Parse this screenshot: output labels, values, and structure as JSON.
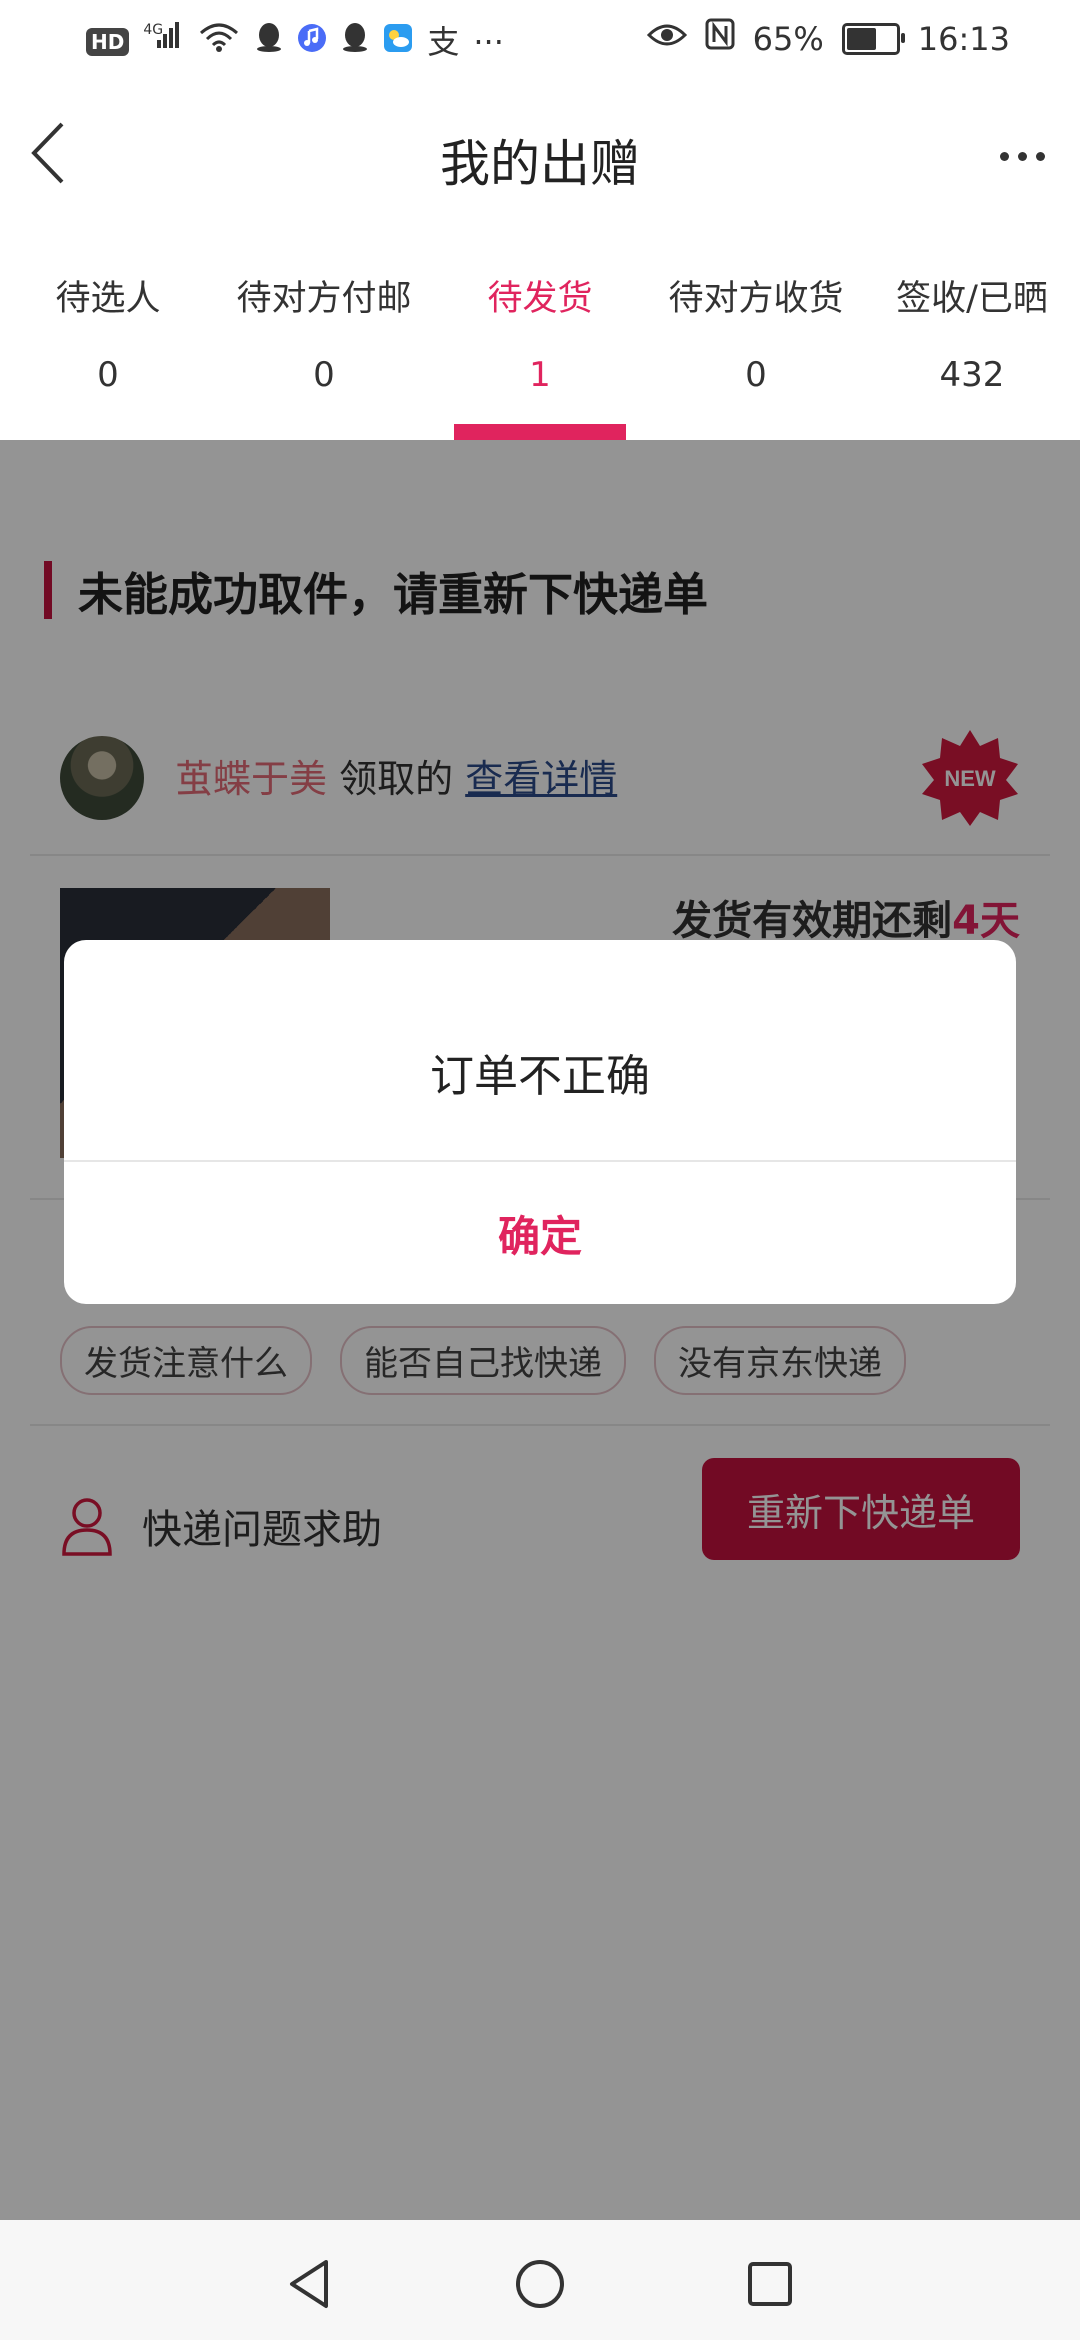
{
  "status_bar": {
    "left_badges": [
      "HD",
      "4G"
    ],
    "icons": [
      "signal-icon",
      "wifi-icon",
      "qq-icon",
      "music-icon",
      "qq-icon",
      "weather-icon",
      "alipay-icon",
      "more-notifications-icon"
    ],
    "alipay_glyph": "支",
    "overflow": "···",
    "battery_percent": "65%",
    "battery_level": 0.65,
    "time": "16:13"
  },
  "header": {
    "title": "我的出赠"
  },
  "tabs": [
    {
      "label": "待选人",
      "count": "0"
    },
    {
      "label": "待对方付邮",
      "count": "0"
    },
    {
      "label": "待发货",
      "count": "1",
      "active": true
    },
    {
      "label": "待对方收货",
      "count": "0"
    },
    {
      "label": "签收/已晒",
      "count": "432"
    }
  ],
  "section": {
    "title": "未能成功取件，请重新下快递单"
  },
  "card": {
    "giver_name": "茧蝶于美",
    "claimed_text": " 领取的 ",
    "details_link": "查看详情",
    "badge": "NEW",
    "deadline_prefix": "发货有效期还剩",
    "deadline_days": "4天",
    "chips": [
      "发货注意什么",
      "能否自己找快递",
      "没有京东快递"
    ],
    "help_text": "快递问题求助",
    "reorder_button": "重新下快递单"
  },
  "dialog": {
    "message": "订单不正确",
    "confirm": "确定"
  },
  "colors": {
    "accent": "#e0245e",
    "button": "#c4123f",
    "link": "#2b4a8a"
  }
}
